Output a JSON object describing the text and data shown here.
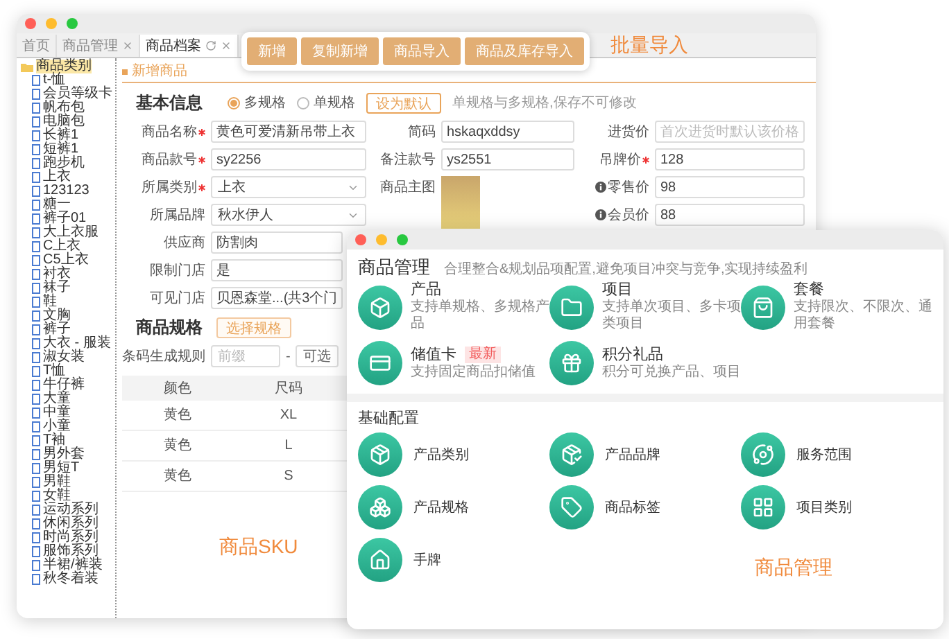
{
  "back_window": {
    "tabs": [
      {
        "label": "首页",
        "selected": false,
        "closable": false
      },
      {
        "label": "商品管理",
        "selected": false,
        "closable": true
      },
      {
        "label": "商品档案",
        "selected": true,
        "closable": true
      }
    ],
    "toolbar": {
      "buttons": [
        "新增",
        "复制新增",
        "商品导入",
        "商品及库存导入"
      ]
    },
    "toolbar_caption": "批量导入",
    "category_tree": {
      "label": "商品类别",
      "selected": true,
      "children": [
        {
          "label": "t-恤",
          "selected": false
        },
        {
          "label": "会员等级卡",
          "selected": false
        },
        {
          "label": "帆布包",
          "selected": false
        },
        {
          "label": "电脑包",
          "selected": false
        },
        {
          "label": "长裤1",
          "selected": false
        },
        {
          "label": "短裤1",
          "selected": false
        },
        {
          "label": "跑步机",
          "selected": false
        },
        {
          "label": "上衣",
          "selected": false
        },
        {
          "label": "123123",
          "selected": false
        },
        {
          "label": "糖一",
          "selected": false
        },
        {
          "label": "裤子01",
          "selected": false
        },
        {
          "label": "大上衣服",
          "selected": false
        },
        {
          "label": "C上衣",
          "selected": false
        },
        {
          "label": "C5上衣",
          "selected": false
        },
        {
          "label": "衬衣",
          "selected": false
        },
        {
          "label": "袜子",
          "selected": false
        },
        {
          "label": "鞋",
          "selected": false
        },
        {
          "label": "文胸",
          "selected": false
        },
        {
          "label": "裤子",
          "selected": false
        },
        {
          "label": "大衣 - 服装",
          "selected": false
        },
        {
          "label": "淑女装",
          "selected": false
        },
        {
          "label": "T恤",
          "selected": false
        },
        {
          "label": "牛仔裤",
          "selected": false
        },
        {
          "label": "大童",
          "selected": false
        },
        {
          "label": "中童",
          "selected": false
        },
        {
          "label": "小童",
          "selected": false
        },
        {
          "label": "T袖",
          "selected": false
        },
        {
          "label": "男外套",
          "selected": false
        },
        {
          "label": "男短T",
          "selected": false
        },
        {
          "label": "男鞋",
          "selected": false
        },
        {
          "label": "女鞋",
          "selected": false
        },
        {
          "label": "运动系列",
          "selected": false
        },
        {
          "label": "休闲系列",
          "selected": false
        },
        {
          "label": "时尚系列",
          "selected": false
        },
        {
          "label": "服饰系列",
          "selected": false
        },
        {
          "label": "半裙/裤装",
          "selected": false
        },
        {
          "label": "秋冬着装",
          "selected": false
        }
      ]
    },
    "panel_title": "新增商品",
    "basic_info": {
      "heading": "基本信息",
      "spec_modes": [
        {
          "label": "多规格",
          "selected": true
        },
        {
          "label": "单规格",
          "selected": false
        }
      ],
      "default_button": "设为默认",
      "note": "单规格与多规格,保存不可修改"
    },
    "field_grid": {
      "column_1": [
        {
          "kind": "text",
          "label": "商品名称",
          "required": true,
          "value": "黄色可爱清新吊带上衣"
        },
        {
          "kind": "text",
          "label": "商品款号",
          "required": true,
          "value": "sy2256"
        },
        {
          "kind": "select",
          "label": "所属类别",
          "required": true,
          "value": "上衣"
        },
        {
          "kind": "select",
          "label": "所属品牌",
          "value": "秋水伊人"
        }
      ],
      "column_2": [
        {
          "kind": "text",
          "label": "简码",
          "value": "hskaqxddsy"
        },
        {
          "kind": "text",
          "label": "备注款号",
          "value": "ys2551"
        },
        {
          "kind": "image",
          "label": "商品主图"
        }
      ],
      "column_3": [
        {
          "kind": "text",
          "label": "进货价",
          "placeholder": "首次进货时默认该价格"
        },
        {
          "kind": "text",
          "label": "吊牌价",
          "required": true,
          "value": "128"
        },
        {
          "kind": "text",
          "label": "零售价",
          "info": true,
          "value": "98"
        },
        {
          "kind": "text",
          "label": "会员价",
          "info": true,
          "value": "88"
        }
      ]
    },
    "more_fields": [
      {
        "kind": "text",
        "label": "供应商",
        "value": "防割肉"
      },
      {
        "kind": "text",
        "label": "限制门店",
        "value": "是"
      },
      {
        "kind": "text",
        "label": "可见门店",
        "value": "贝恩森堂...(共3个门"
      }
    ],
    "spec": {
      "heading": "商品规格",
      "button": "选择规格",
      "barcode_rule": {
        "label": "条码生成规则",
        "prefix_placeholder": "前缀",
        "separator": "-",
        "second_placeholder": "可选"
      }
    },
    "sku_table": {
      "columns": [
        "颜色",
        "尺码"
      ],
      "rows": [
        [
          "黄色",
          "XL"
        ],
        [
          "黄色",
          "L"
        ],
        [
          "黄色",
          "S"
        ]
      ]
    },
    "caption": "商品SKU"
  },
  "front_window": {
    "goods_section": {
      "title": "商品管理",
      "subtitle": "合理整合&规划品项配置,避免项目冲突与竞争,实现持续盈利",
      "items": [
        {
          "name": "产品",
          "desc": "支持单规格、多规格产品"
        },
        {
          "name": "项目",
          "desc": "支持单次项目、多卡项类项目"
        },
        {
          "name": "套餐",
          "desc": "支持限次、不限次、通用套餐"
        },
        {
          "name": "储值卡",
          "badge": "最新",
          "desc": "支持固定商品扣储值"
        },
        {
          "name": "积分礼品",
          "desc": "积分可兑换产品、项目"
        }
      ]
    },
    "config_section": {
      "title": "基础配置",
      "items": [
        "产品类别",
        "产品品牌",
        "服务范围",
        "产品规格",
        "商品标签",
        "项目类别",
        "手牌"
      ]
    },
    "caption": "商品管理"
  }
}
